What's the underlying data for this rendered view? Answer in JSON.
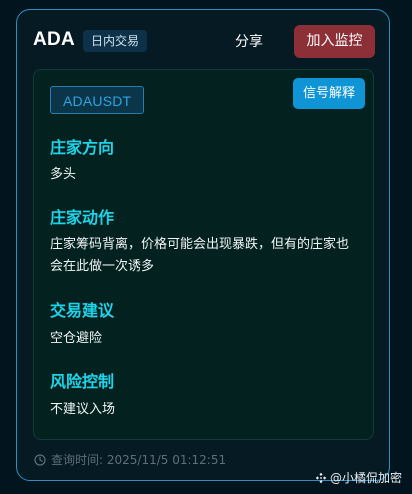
{
  "header": {
    "coin": "ADA",
    "trade_type": "日内交易",
    "share_label": "分享",
    "monitor_label": "加入监控"
  },
  "signal": {
    "symbol": "ADAUSDT",
    "explain_label": "信号解释",
    "sections": [
      {
        "title": "庄家方向",
        "content": "多头"
      },
      {
        "title": "庄家动作",
        "content": "庄家筹码背离，价格可能会出现暴跌，但有的庄家也会在此做一次诱多"
      },
      {
        "title": "交易建议",
        "content": "空仓避险"
      },
      {
        "title": "风险控制",
        "content": "不建议入场"
      }
    ]
  },
  "footer": {
    "query_time": "查询时间: 2025/11/5 01:12:51",
    "icon": "clock-icon"
  },
  "watermark": {
    "text": "@小橘侃加密",
    "icon": "diamond-logo-icon"
  },
  "colors": {
    "background": "#02141d",
    "card_border": "#2e90c4",
    "accent_cyan": "#1fd3e8",
    "monitor_button": "#8c2f36",
    "explain_button": "#0f95d6"
  }
}
